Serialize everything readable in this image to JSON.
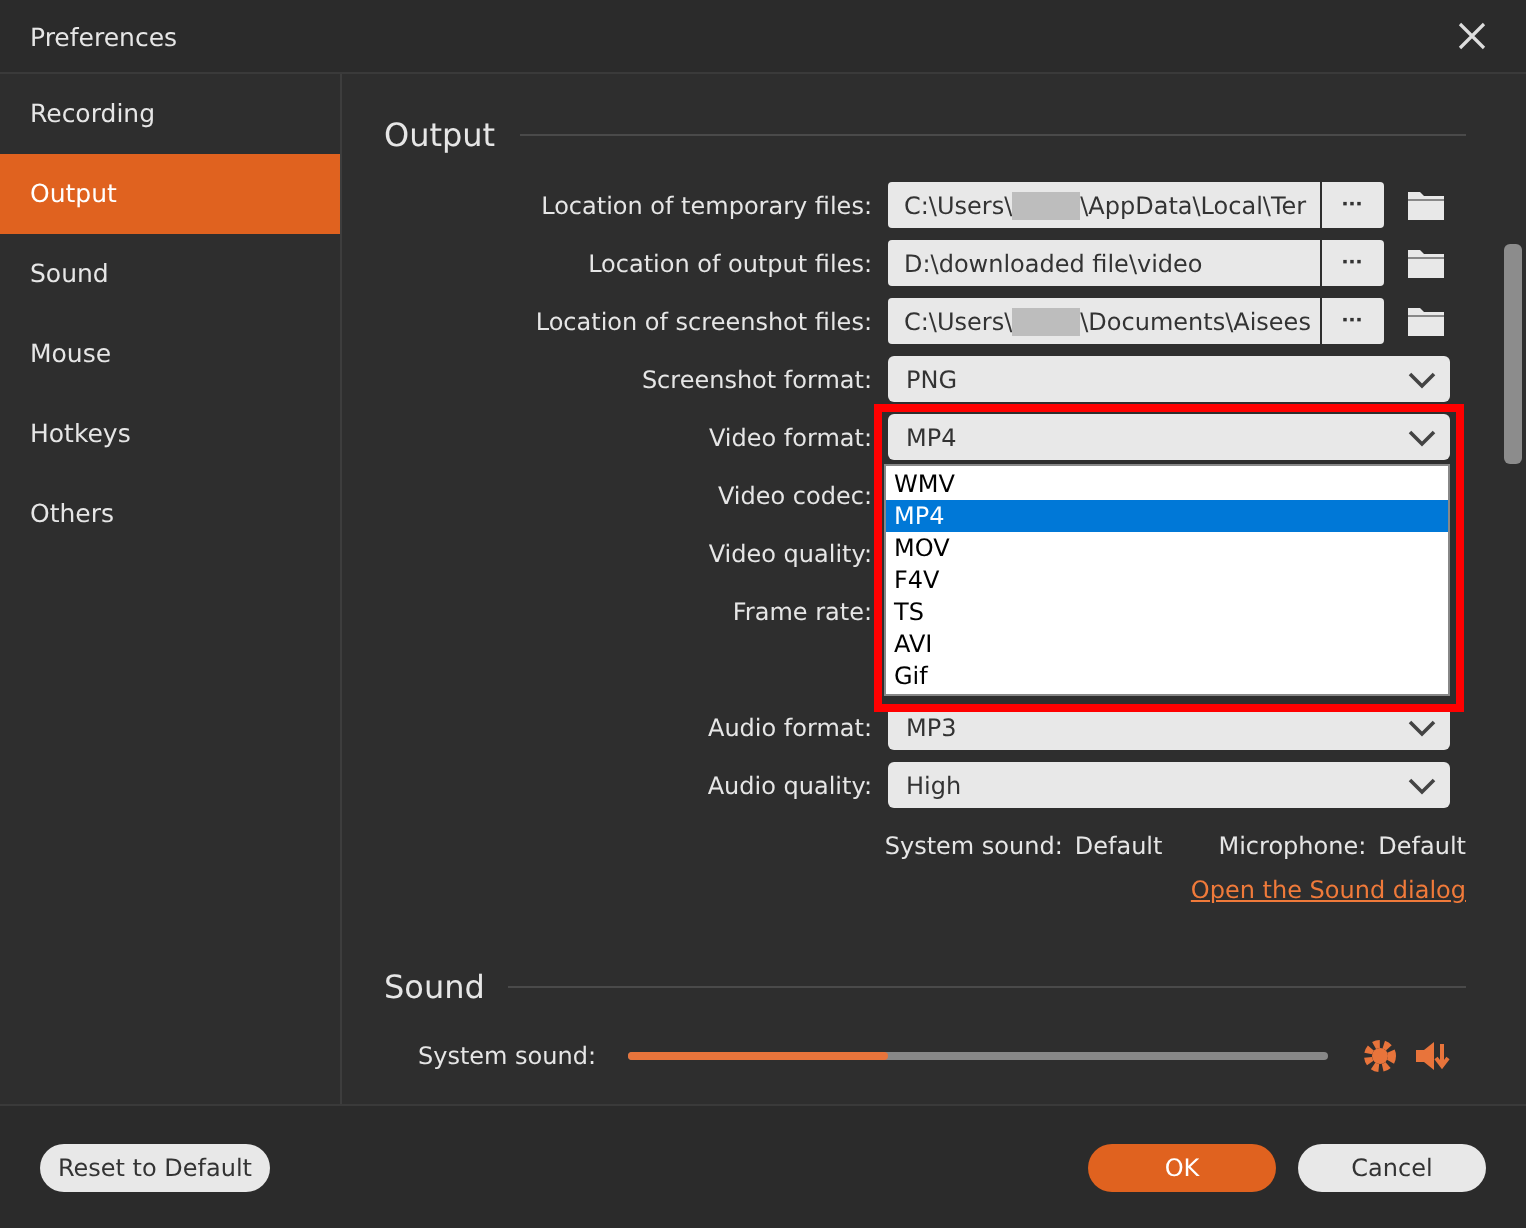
{
  "window": {
    "title": "Preferences"
  },
  "sidebar": {
    "items": [
      {
        "label": "Recording",
        "selected": false
      },
      {
        "label": "Output",
        "selected": true
      },
      {
        "label": "Sound",
        "selected": false
      },
      {
        "label": "Mouse",
        "selected": false
      },
      {
        "label": "Hotkeys",
        "selected": false
      },
      {
        "label": "Others",
        "selected": false
      }
    ]
  },
  "output": {
    "heading": "Output",
    "rows": [
      {
        "kind": "path",
        "label": "Location of temporary files:",
        "before": "C:\\Users\\",
        "redacted": true,
        "after": "\\AppData\\Local\\Ter",
        "browse": "▪▪▪"
      },
      {
        "kind": "path",
        "label": "Location of output files:",
        "before": "D:\\downloaded file\\video",
        "redacted": false,
        "browse": "▪▪▪"
      },
      {
        "kind": "path",
        "label": "Location of screenshot files:",
        "before": "C:\\Users\\",
        "redacted": true,
        "after": "\\Documents\\Aisees",
        "browse": "▪▪▪"
      },
      {
        "kind": "select",
        "label": "Screenshot format:",
        "value": "PNG"
      },
      {
        "kind": "select",
        "label": "Video format:",
        "value": "MP4",
        "open": true,
        "options": [
          {
            "label": "WMV",
            "selected": false
          },
          {
            "label": "MP4",
            "selected": true
          },
          {
            "label": "MOV",
            "selected": false
          },
          {
            "label": "F4V",
            "selected": false
          },
          {
            "label": "TS",
            "selected": false
          },
          {
            "label": "AVI",
            "selected": false
          },
          {
            "label": "Gif",
            "selected": false
          }
        ]
      },
      {
        "kind": "covered",
        "label": "Video codec:"
      },
      {
        "kind": "covered",
        "label": "Video quality:"
      },
      {
        "kind": "covered",
        "label": "Frame rate:"
      },
      {
        "kind": "blank"
      },
      {
        "kind": "select",
        "label": "Audio format:",
        "value": "MP3"
      },
      {
        "kind": "select",
        "label": "Audio quality:",
        "value": "High"
      }
    ],
    "devices": [
      {
        "label": "System sound:",
        "value": "Default"
      },
      {
        "label": "Microphone:",
        "value": "Default"
      }
    ],
    "link": "Open the Sound dialog"
  },
  "annotation": {
    "kind": "highlight-box"
  },
  "sound": {
    "heading": "Sound",
    "slider": {
      "label": "System sound:",
      "level": 0.37
    }
  },
  "footer": {
    "reset": "Reset to Default",
    "ok": "OK",
    "cancel": "Cancel"
  }
}
